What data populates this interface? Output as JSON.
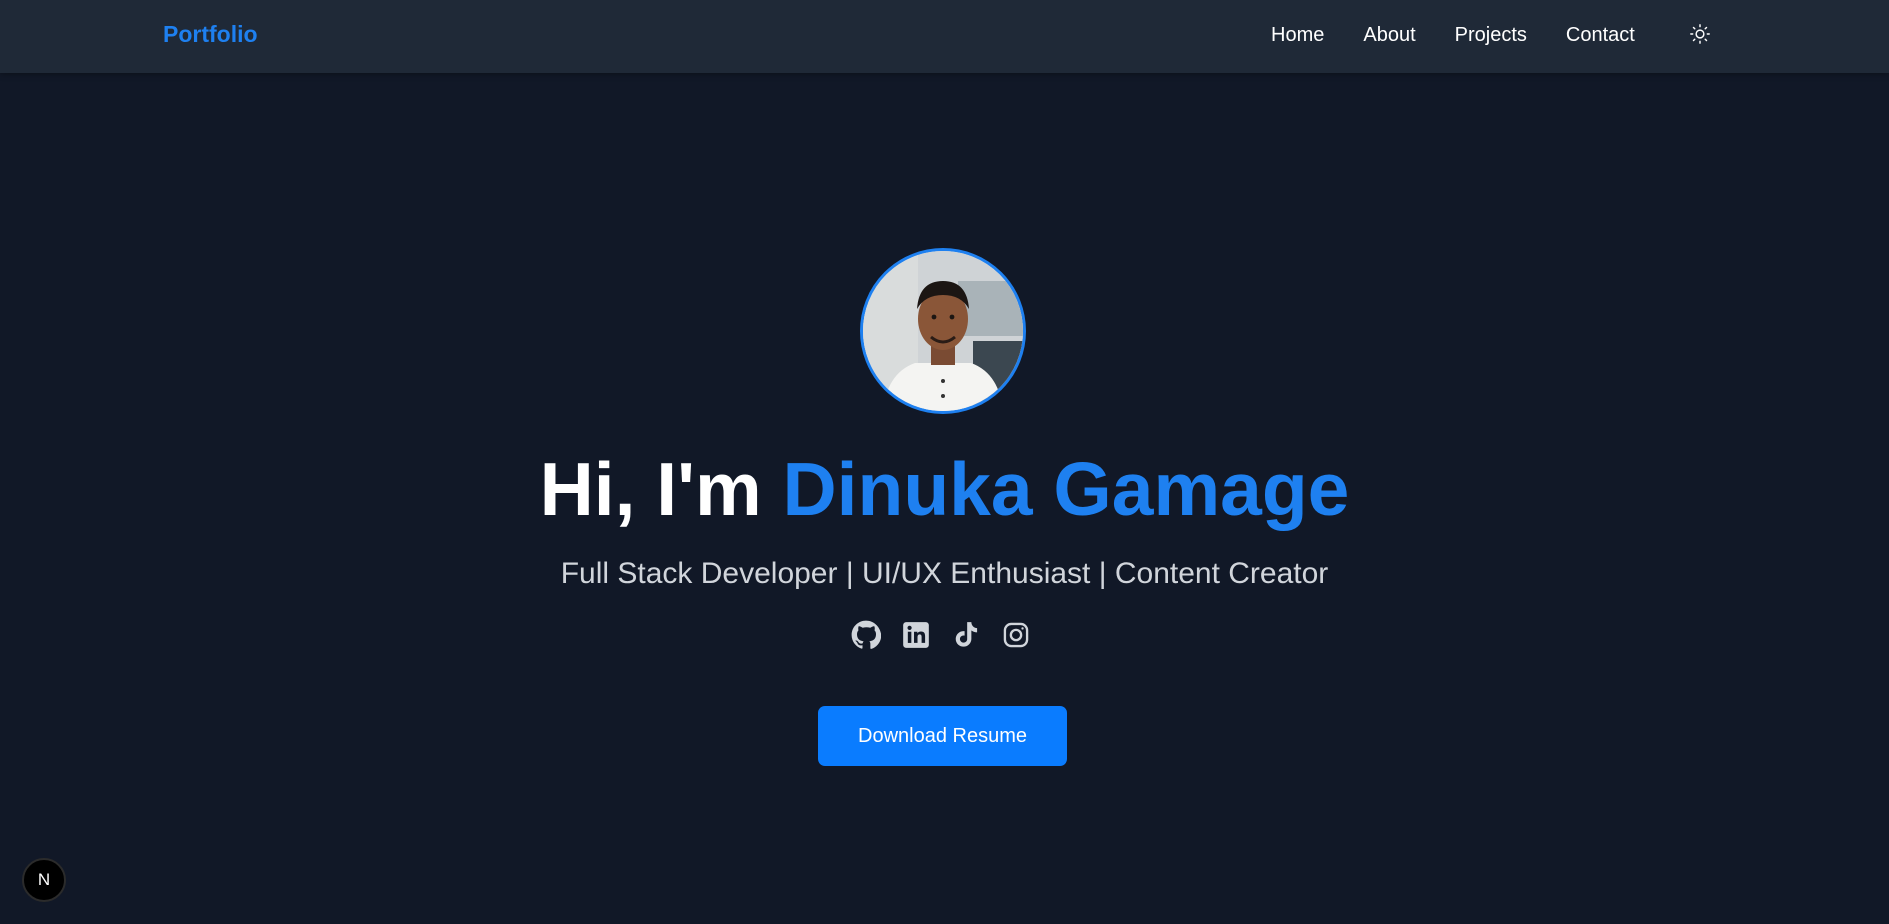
{
  "navbar": {
    "brand": "Portfolio",
    "links": [
      {
        "label": "Home"
      },
      {
        "label": "About"
      },
      {
        "label": "Projects"
      },
      {
        "label": "Contact"
      }
    ],
    "theme_toggle_icon": "sun-icon"
  },
  "hero": {
    "greeting": "Hi, I'm",
    "name": "Dinuka Gamage",
    "subtitle": "Full Stack Developer | UI/UX Enthusiast | Content Creator",
    "avatar_icon": "profile-photo",
    "social_icons": [
      "github-icon",
      "linkedin-icon",
      "tiktok-icon",
      "instagram-icon"
    ],
    "resume_button": "Download Resume"
  },
  "dev_badge": {
    "label": "N"
  },
  "colors": {
    "background": "#111827",
    "navbar": "#1f2937",
    "accent": "#1e80f0",
    "button": "#0a7cff",
    "subtitle": "#d1d5db"
  }
}
